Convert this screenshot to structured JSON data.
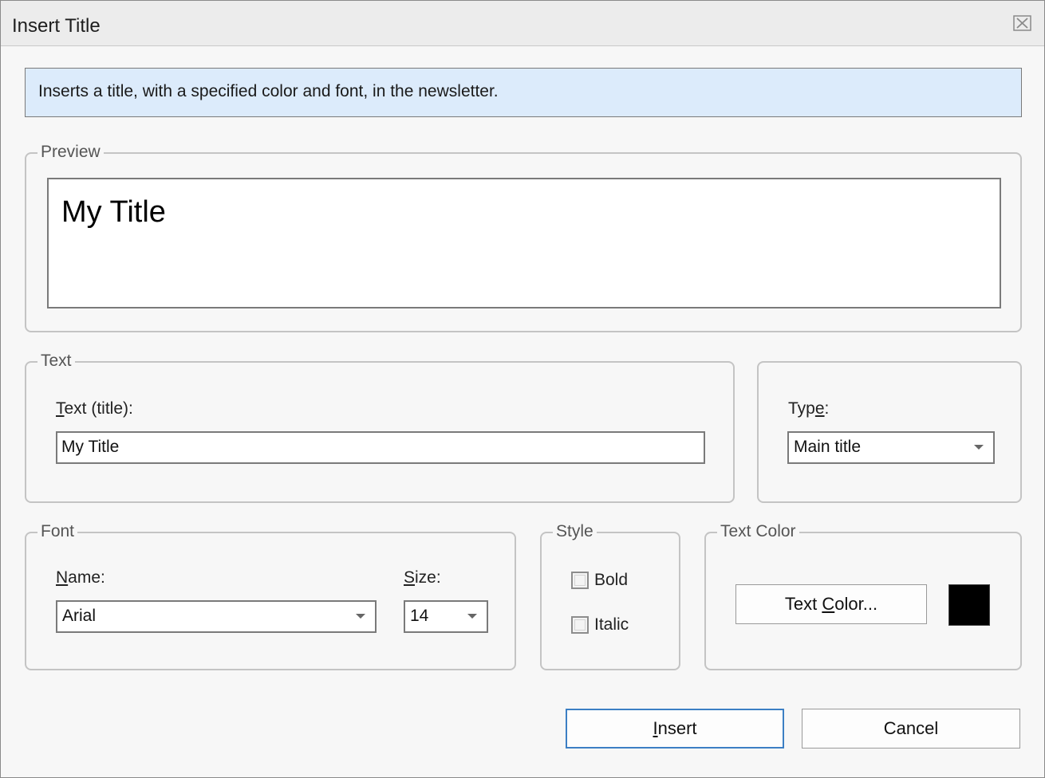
{
  "window": {
    "title": "Insert Title"
  },
  "banner": {
    "text": "Inserts a title, with a specified color and font, in the newsletter."
  },
  "preview": {
    "legend": "Preview",
    "sample_text": "My Title"
  },
  "text_group": {
    "legend": "Text",
    "label_mnemonic": "T",
    "label_rest": "ext (title):",
    "value": "My Title"
  },
  "type_group": {
    "label_pre": "Typ",
    "label_mnemonic": "e",
    "label_post": ":",
    "selected": "Main title"
  },
  "font_group": {
    "legend": "Font",
    "name_mnemonic": "N",
    "name_rest": "ame:",
    "name_value": "Arial",
    "size_mnemonic": "S",
    "size_rest": "ize:",
    "size_value": "14"
  },
  "style_group": {
    "legend": "Style",
    "bold_label": "Bold",
    "bold_checked": false,
    "italic_label": "Italic",
    "italic_checked": false
  },
  "color_group": {
    "legend": "Text Color",
    "button_pre": "Text ",
    "button_mnemonic": "C",
    "button_post": "olor...",
    "swatch_color": "#000000"
  },
  "footer": {
    "insert_mnemonic": "I",
    "insert_rest": "nsert",
    "cancel_label": "Cancel"
  }
}
